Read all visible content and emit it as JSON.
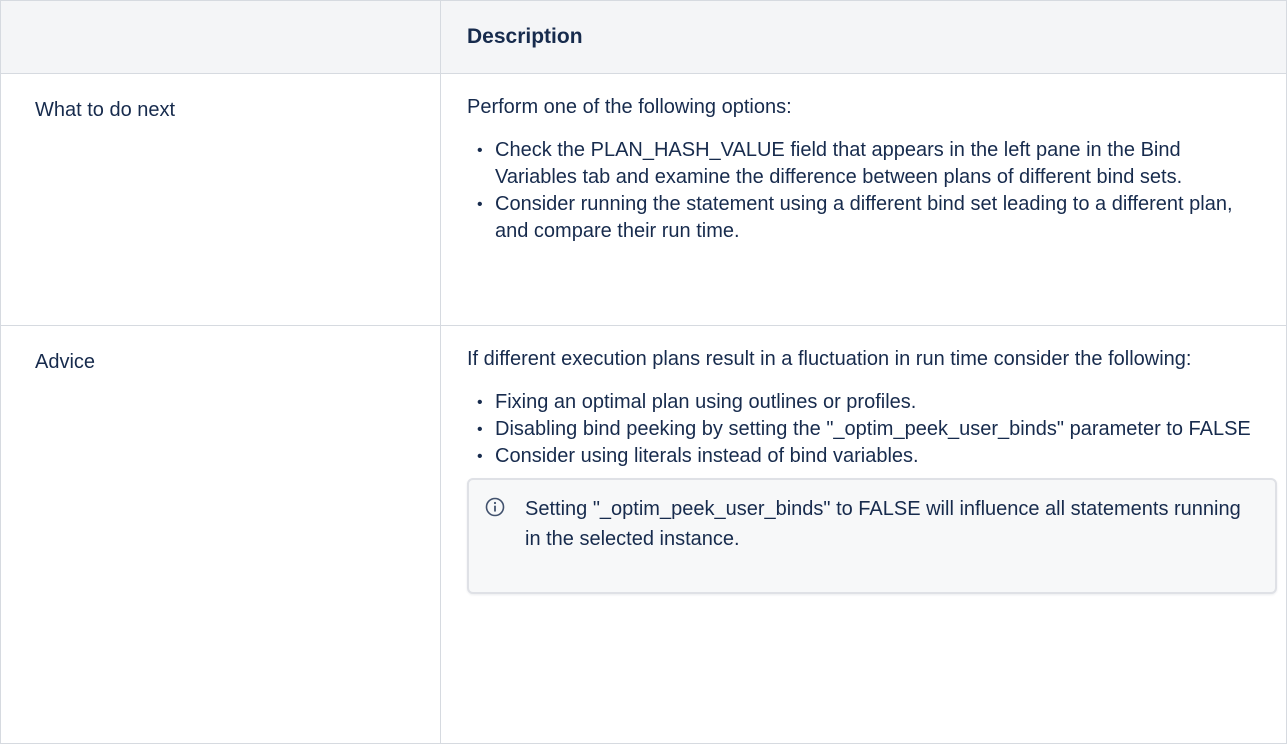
{
  "table": {
    "header": {
      "left": "",
      "right": "Description"
    },
    "rows": [
      {
        "label": "What to do next",
        "intro": "Perform one of the following options:",
        "bullets": [
          "Check the PLAN_HASH_VALUE field that appears in the left pane in the Bind Variables tab and examine the difference between plans of different bind sets.",
          "Consider running the statement using a different bind set leading to a different plan, and compare their run time."
        ]
      },
      {
        "label": "Advice",
        "intro": "If different execution plans result in a fluctuation in run time consider the following:",
        "bullets": [
          "Fixing an optimal plan using outlines or profiles.",
          "Disabling bind peeking by setting the \"_optim_peek_user_binds\" parameter to FALSE",
          "Consider using literals instead of bind variables."
        ],
        "info_panel": {
          "icon": "info-icon",
          "text": "Setting \"_optim_peek_user_binds\" to FALSE will influence all statements running in the selected instance."
        }
      }
    ]
  }
}
